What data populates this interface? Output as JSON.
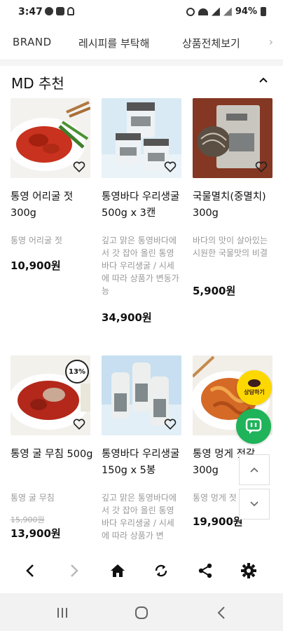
{
  "status_bar": {
    "time": "3:47",
    "battery": "94%"
  },
  "top_nav": {
    "items": [
      "BRAND",
      "레시피를 부탁해",
      "상품전체보기"
    ],
    "more_icon": "chevron-right-icon"
  },
  "section": {
    "title": "MD 추천",
    "collapse_icon": "chevron-up-icon"
  },
  "products": [
    {
      "name": "통영 어리굴 젓 300g",
      "description": "통영 어리굴 젓",
      "original_price": "",
      "price": "10,900원",
      "discount": ""
    },
    {
      "name": "통영바다 우리생굴 500g x 3캔",
      "description": "깊고 맑은 통영바다에서 갓 잡아 올린 통영바다 우리생굴 / 시세에 따라 상품가 변동가능",
      "original_price": "",
      "price": "34,900원",
      "discount": ""
    },
    {
      "name": "국물멸치(중멸치) 300g",
      "description": "바다의 맛이 살아있는 시원한 국물맛의 비결",
      "original_price": "",
      "price": "5,900원",
      "discount": ""
    },
    {
      "name": "통영 굴 무침 500g",
      "description": "통영 굴 무침",
      "original_price": "15,900원",
      "price": "13,900원",
      "discount": "13%"
    },
    {
      "name": "통영바다 우리생굴 150g x 5봉",
      "description": "깊고 맑은 통영바다에서 갓 잡아 올린 통영바다 우리생굴 / 시세에 따라 상품가 변",
      "original_price": "",
      "price": "",
      "discount": ""
    },
    {
      "name": "통영 멍게 젓갈 300g",
      "description": "통영 멍게 젓",
      "original_price": "",
      "price": "19,900원",
      "discount": ""
    }
  ],
  "floating": {
    "kakao_label": "상담하기"
  },
  "colors": {
    "accent_green": "#1fb35a",
    "kakao_yellow": "#fcd800"
  }
}
